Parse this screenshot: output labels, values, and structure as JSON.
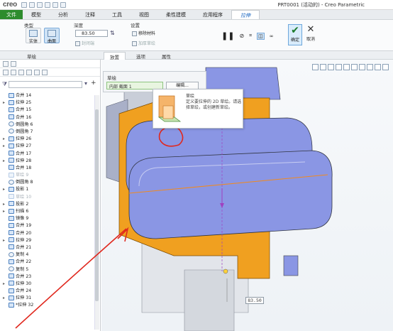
{
  "app": {
    "logo": "creo",
    "window_title": "PRT0001 (活动的) - Creo Parametric"
  },
  "tabs": [
    {
      "label": "文件"
    },
    {
      "label": "模型"
    },
    {
      "label": "分析"
    },
    {
      "label": "注释"
    },
    {
      "label": "工具"
    },
    {
      "label": "视图"
    },
    {
      "label": "柔性建模"
    },
    {
      "label": "应用程序"
    },
    {
      "label": "拉伸"
    }
  ],
  "ribbon": {
    "type_group": {
      "title": "类型",
      "solid_label": "实体",
      "surface_label": "曲面"
    },
    "depth_group": {
      "title": "深度",
      "value": "83.50",
      "closed_label": "封闭端"
    },
    "settings_group": {
      "title": "设置",
      "remove_material": "移除材料",
      "add_taper": "加厚草绘"
    },
    "ok_label": "确定",
    "cancel_label": "取消"
  },
  "subtabs": {
    "sketch_label": "草绘",
    "placement": "放置",
    "options": "选项",
    "properties": "属性"
  },
  "placement_panel": {
    "title": "草绘",
    "selected": "内部 截面 1",
    "edit_button": "编辑..."
  },
  "tooltip": {
    "title": "草绘",
    "description": "定义要拉伸的 2D 草绘。请选择草绘，或创建新草绘。"
  },
  "tree": {
    "items": [
      {
        "label": "合并 14",
        "icon": "merge-icon",
        "twisty": false,
        "dim": false
      },
      {
        "label": "拉伸 25",
        "icon": "extrude-icon",
        "twisty": true,
        "dim": false
      },
      {
        "label": "合并 15",
        "icon": "merge-icon",
        "twisty": false,
        "dim": false
      },
      {
        "label": "合并 16",
        "icon": "merge-icon",
        "twisty": false,
        "dim": false
      },
      {
        "label": "倒圆角 6",
        "icon": "round-icon",
        "twisty": false,
        "dim": false
      },
      {
        "label": "倒圆角 7",
        "icon": "round-icon",
        "twisty": false,
        "dim": false
      },
      {
        "label": "拉伸 26",
        "icon": "extrude-icon",
        "twisty": true,
        "dim": false
      },
      {
        "label": "拉伸 27",
        "icon": "extrude-icon",
        "twisty": true,
        "dim": false
      },
      {
        "label": "合并 17",
        "icon": "merge-icon",
        "twisty": false,
        "dim": false
      },
      {
        "label": "拉伸 28",
        "icon": "extrude-icon",
        "twisty": true,
        "dim": false
      },
      {
        "label": "合并 18",
        "icon": "merge-icon",
        "twisty": false,
        "dim": false
      },
      {
        "label": "草绘 9",
        "icon": "sketch-icon",
        "twisty": false,
        "dim": true
      },
      {
        "label": "倒圆角 8",
        "icon": "round-icon",
        "twisty": false,
        "dim": false
      },
      {
        "label": "投影 1",
        "icon": "project-icon",
        "twisty": true,
        "dim": false
      },
      {
        "label": "草绘 10",
        "icon": "sketch-icon",
        "twisty": false,
        "dim": true
      },
      {
        "label": "投影 2",
        "icon": "project-icon",
        "twisty": true,
        "dim": false
      },
      {
        "label": "扫描 6",
        "icon": "sweep-icon",
        "twisty": true,
        "dim": false
      },
      {
        "label": "镜像 9",
        "icon": "mirror-icon",
        "twisty": false,
        "dim": false
      },
      {
        "label": "合并 19",
        "icon": "merge-icon",
        "twisty": false,
        "dim": false
      },
      {
        "label": "合并 20",
        "icon": "merge-icon",
        "twisty": false,
        "dim": false
      },
      {
        "label": "拉伸 29",
        "icon": "extrude-icon",
        "twisty": true,
        "dim": false
      },
      {
        "label": "合并 21",
        "icon": "merge-icon",
        "twisty": false,
        "dim": false
      },
      {
        "label": "复制 4",
        "icon": "copy-icon",
        "twisty": false,
        "dim": false
      },
      {
        "label": "合并 22",
        "icon": "merge-icon",
        "twisty": false,
        "dim": false
      },
      {
        "label": "复制 5",
        "icon": "copy-icon",
        "twisty": false,
        "dim": false
      },
      {
        "label": "合并 23",
        "icon": "merge-icon",
        "twisty": false,
        "dim": false
      },
      {
        "label": "拉伸 30",
        "icon": "extrude-icon",
        "twisty": true,
        "dim": false
      },
      {
        "label": "合并 24",
        "icon": "merge-icon",
        "twisty": false,
        "dim": false
      },
      {
        "label": "拉伸 31",
        "icon": "extrude-icon",
        "twisty": true,
        "dim": false
      },
      {
        "label": "*拉伸 32",
        "icon": "extrude-icon",
        "twisty": false,
        "dim": false
      }
    ]
  },
  "viewport": {
    "dimension_value": "83.50"
  },
  "colors": {
    "file_tab": "#2d8c2d",
    "orange_surface": "#f0a020",
    "model_blue": "#8a96e4",
    "annotation_red": "#e0281e"
  }
}
